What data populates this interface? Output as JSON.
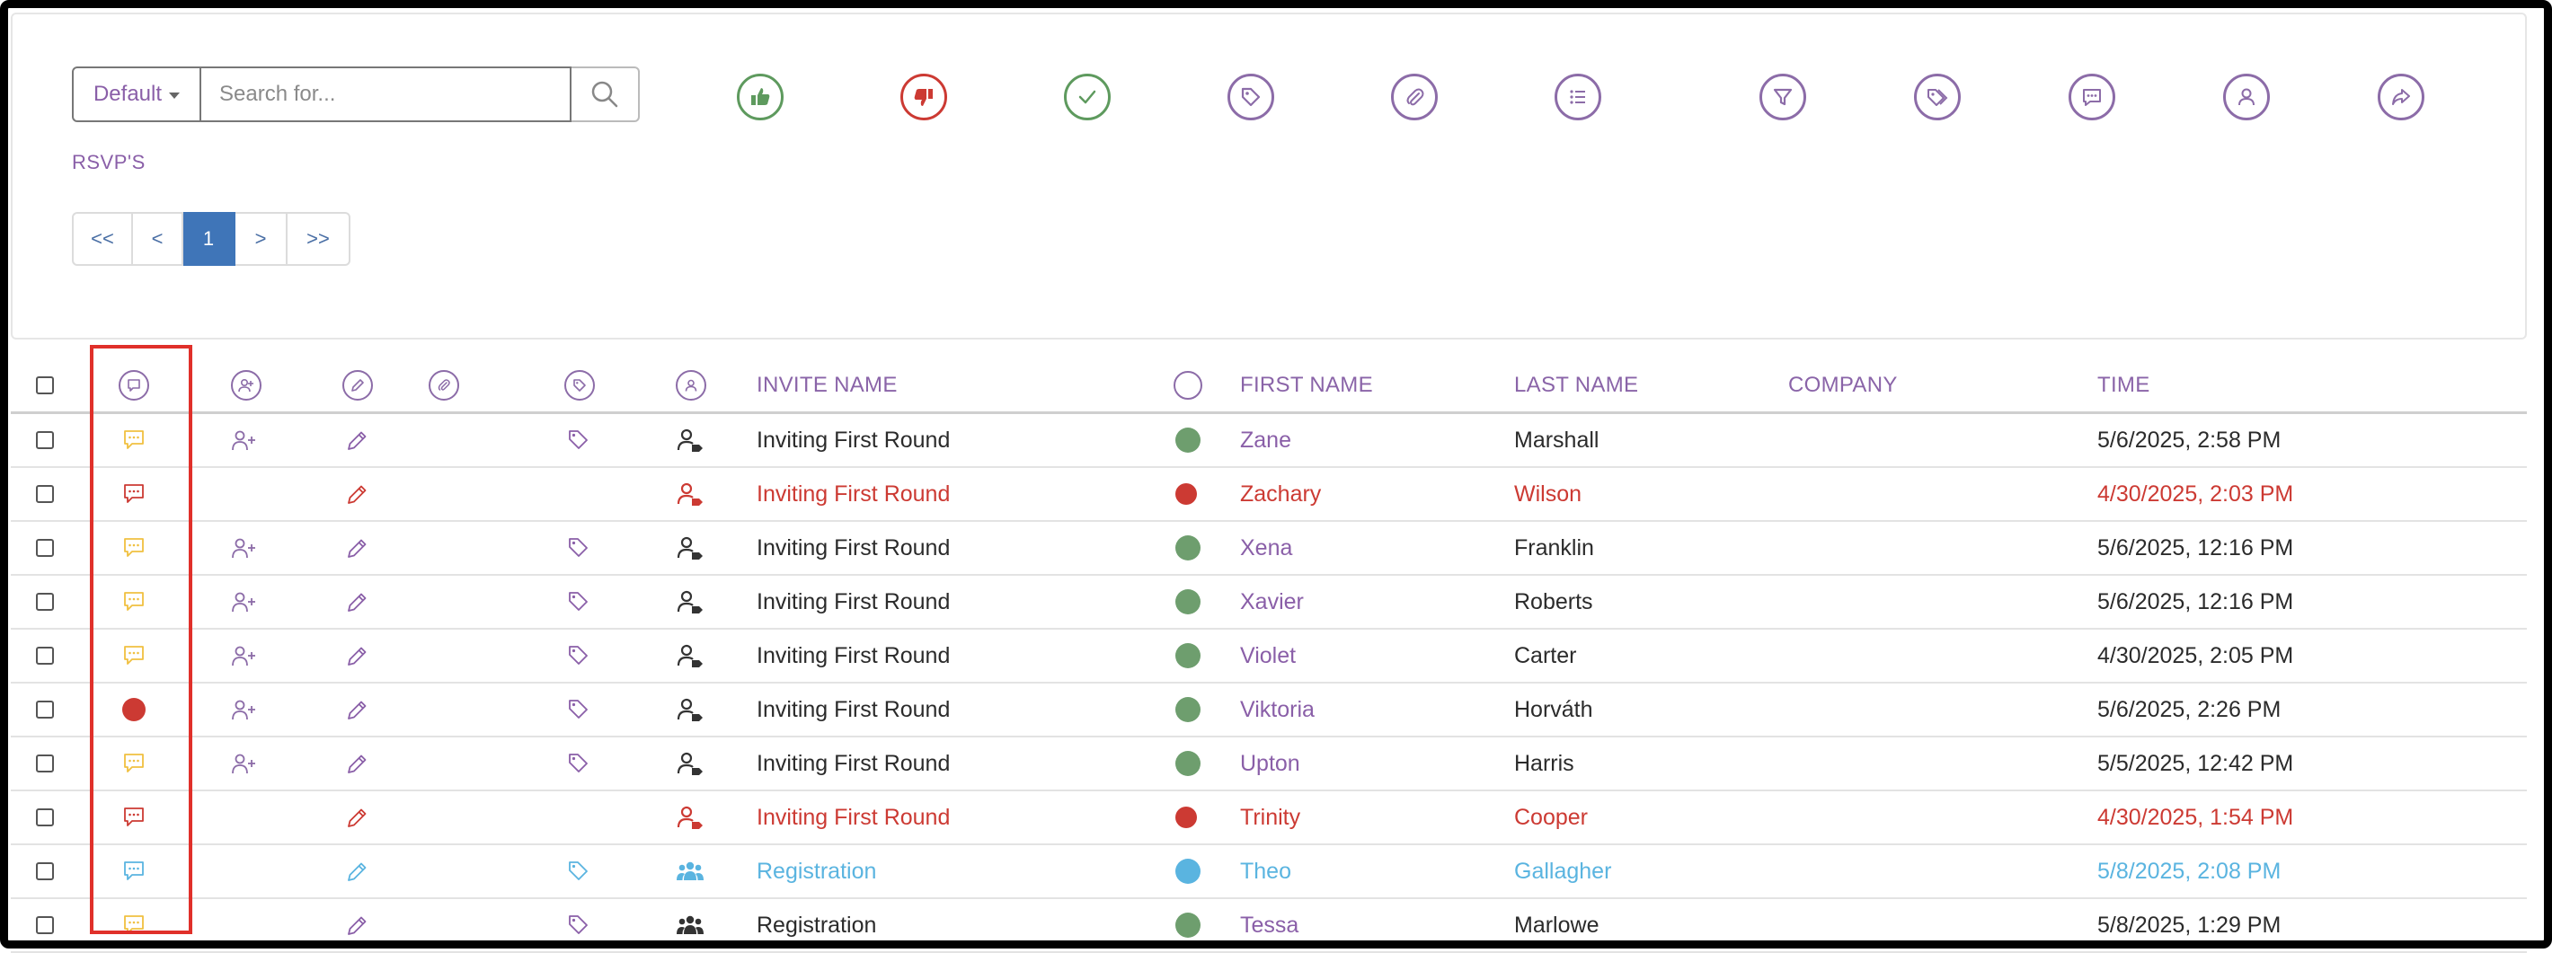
{
  "toolbar": {
    "default_label": "Default",
    "search_placeholder": "Search for...",
    "icons": [
      "thumbs-up-icon",
      "thumbs-down-icon",
      "check-icon",
      "tag-icon",
      "paperclip-icon",
      "list-icon",
      "filter-icon",
      "tags-icon",
      "comment-icon",
      "user-icon",
      "share-icon"
    ]
  },
  "section_label": "RSVP'S",
  "pagination": {
    "first": "<<",
    "prev": "<",
    "current": "1",
    "next": ">",
    "last": ">>"
  },
  "table": {
    "headers": {
      "invite_name": "INVITE NAME",
      "first_name": "FIRST NAME",
      "last_name": "LAST NAME",
      "company": "COMPANY",
      "time": "TIME"
    },
    "rows": [
      {
        "status": "normal",
        "note": "comment-yellow",
        "add_guest": true,
        "tag": true,
        "person": "user-dark",
        "invite": "Inviting First Round",
        "first": "Zane",
        "last": "Marshall",
        "company": "",
        "time": "5/6/2025, 2:58 PM",
        "dot": "#6e9e6e"
      },
      {
        "status": "declined",
        "note": "comment-red",
        "add_guest": false,
        "tag": false,
        "person": "user-red",
        "invite": "Inviting First Round",
        "first": "Zachary",
        "last": "Wilson",
        "company": "",
        "time": "4/30/2025, 2:03 PM",
        "dot": "#cc3a33"
      },
      {
        "status": "normal",
        "note": "comment-yellow",
        "add_guest": true,
        "tag": true,
        "person": "user-dark",
        "invite": "Inviting First Round",
        "first": "Xena",
        "last": "Franklin",
        "company": "",
        "time": "5/6/2025, 12:16 PM",
        "dot": "#6e9e6e"
      },
      {
        "status": "normal",
        "note": "comment-yellow",
        "add_guest": true,
        "tag": true,
        "person": "user-dark",
        "invite": "Inviting First Round",
        "first": "Xavier",
        "last": "Roberts",
        "company": "",
        "time": "5/6/2025, 12:16 PM",
        "dot": "#6e9e6e"
      },
      {
        "status": "normal",
        "note": "comment-yellow",
        "add_guest": true,
        "tag": true,
        "person": "user-dark",
        "invite": "Inviting First Round",
        "first": "Violet",
        "last": "Carter",
        "company": "",
        "time": "4/30/2025, 2:05 PM",
        "dot": "#6e9e6e"
      },
      {
        "status": "normal",
        "note": "red-dot",
        "add_guest": true,
        "tag": true,
        "person": "user-dark",
        "invite": "Inviting First Round",
        "first": "Viktoria",
        "last": "Horváth",
        "company": "",
        "time": "5/6/2025, 2:26 PM",
        "dot": "#6e9e6e"
      },
      {
        "status": "normal",
        "note": "comment-yellow",
        "add_guest": true,
        "tag": true,
        "person": "user-dark",
        "invite": "Inviting First Round",
        "first": "Upton",
        "last": "Harris",
        "company": "",
        "time": "5/5/2025, 12:42 PM",
        "dot": "#6e9e6e"
      },
      {
        "status": "declined",
        "note": "comment-red",
        "add_guest": false,
        "tag": false,
        "person": "user-red",
        "invite": "Inviting First Round",
        "first": "Trinity",
        "last": "Cooper",
        "company": "",
        "time": "4/30/2025, 1:54 PM",
        "dot": "#cc3a33"
      },
      {
        "status": "registration",
        "note": "comment-blue",
        "add_guest": false,
        "tag": true,
        "person": "group-blue",
        "invite": "Registration",
        "first": "Theo",
        "last": "Gallagher",
        "company": "",
        "time": "5/8/2025, 2:08 PM",
        "dot": "#5ab4e0"
      },
      {
        "status": "normal",
        "note": "comment-yellow",
        "add_guest": false,
        "tag": true,
        "person": "group-dark",
        "invite": "Registration",
        "first": "Tessa",
        "last": "Marlowe",
        "company": "",
        "time": "5/8/2025, 1:29 PM",
        "dot": "#6e9e6e"
      }
    ]
  },
  "colors": {
    "accent": "#8a5fa8",
    "declined": "#cc3a33",
    "registration": "#5ab4e0",
    "confirmed": "#6e9e6e",
    "comment_yellow": "#f0c040",
    "pager_active": "#3f75b8",
    "highlight": "#e0302a"
  }
}
